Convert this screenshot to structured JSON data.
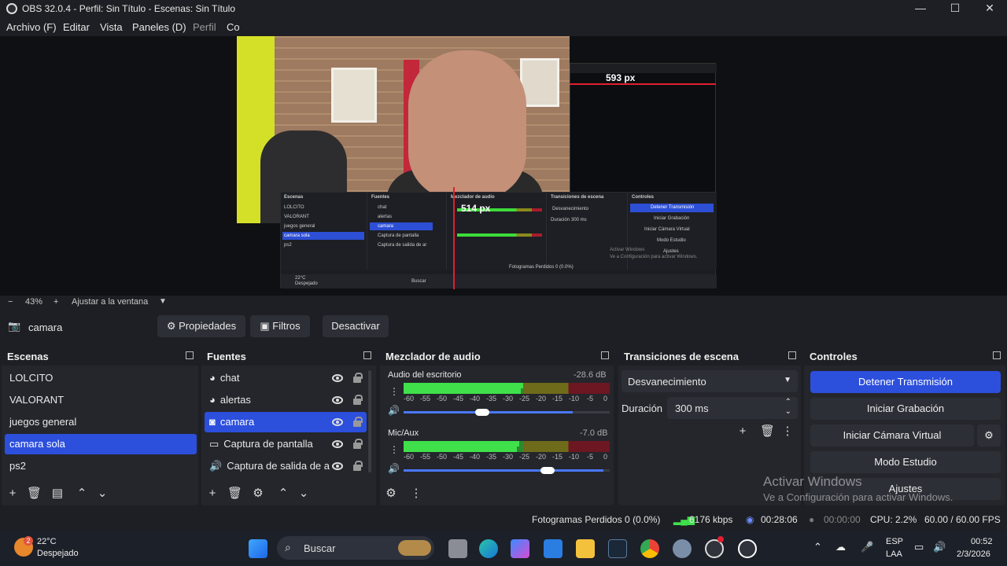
{
  "window": {
    "title": "OBS 32.0.4 - Perfil: Sin Título - Escenas: Sin Título",
    "minimize": "—",
    "maximize": "☐",
    "close": "✕"
  },
  "menu": [
    "Archivo (F)",
    "Editar",
    "Vista",
    "Paneles (D)",
    "Perfil",
    "Co"
  ],
  "preview": {
    "measure_h": "593 px",
    "measure_v": "514 px",
    "mini": {
      "scenes_title": "Escenas",
      "sources_title": "Fuentes",
      "mixer_title": "Mezclador de audio",
      "transitions_title": "Transiciones de escena",
      "controls_title": "Controles",
      "scenes": [
        "LOLCITO",
        "VALORANT",
        "juegos general",
        "camara sola",
        "ps2"
      ],
      "sources": [
        "chat",
        "alertas",
        "camara",
        "Captura de pantalla",
        "Captura de salida de ar"
      ],
      "stop": "Detener Transmisión",
      "record": "Iniciar Grabación",
      "virtual": "Iniciar Cámara Virtual",
      "studio": "Modo Estudio",
      "settings": "Ajustes",
      "fade": "Desvanecimiento",
      "duration": "Duración",
      "duration_val": "300 ms",
      "watermark1": "Activar Windows",
      "watermark2": "Ve a Configuración para activar Windows.",
      "status": "Fotogramas Perdidos 0 (0.0%)",
      "search": "Buscar",
      "weather_temp": "22°C",
      "weather_text": "Despejado"
    }
  },
  "zoom": {
    "minus": "−",
    "value": "43%",
    "plus": "+",
    "fit": "Ajustar a la ventana"
  },
  "source_bar": {
    "name": "camara",
    "properties": "Propiedades",
    "filters": "Filtros",
    "deactivate": "Desactivar"
  },
  "scenes": {
    "title": "Escenas",
    "items": [
      "LOLCITO",
      "VALORANT",
      "juegos general",
      "camara sola",
      "ps2"
    ],
    "selected_index": 3
  },
  "sources": {
    "title": "Fuentes",
    "items": [
      {
        "label": "chat",
        "icon": "browser-icon"
      },
      {
        "label": "alertas",
        "icon": "browser-icon"
      },
      {
        "label": "camara",
        "icon": "camera-icon"
      },
      {
        "label": "Captura de pantalla",
        "icon": "monitor-icon"
      },
      {
        "label": "Captura de salida de a",
        "icon": "speaker-icon"
      }
    ],
    "selected_index": 2
  },
  "mixer": {
    "title": "Mezclador de audio",
    "tracks": [
      {
        "name": "Audio del escritorio",
        "db": "-28.6 dB",
        "level": 0.58,
        "volume": 0.82
      },
      {
        "name": "Mic/Aux",
        "db": "-7.0 dB",
        "level": 0.56,
        "volume": 0.97
      }
    ],
    "scale": [
      "-60",
      "-55",
      "-50",
      "-45",
      "-40",
      "-35",
      "-30",
      "-25",
      "-20",
      "-15",
      "-10",
      "-5",
      "0"
    ]
  },
  "transitions": {
    "title": "Transiciones de escena",
    "selected": "Desvanecimiento",
    "duration_label": "Duración",
    "duration_value": "300 ms"
  },
  "controls": {
    "title": "Controles",
    "stop_stream": "Detener Transmisión",
    "start_record": "Iniciar Grabación",
    "virtual_cam": "Iniciar Cámara Virtual",
    "studio_mode": "Modo Estudio",
    "settings": "Ajustes"
  },
  "watermark": {
    "line1": "Activar Windows",
    "line2": "Ve a Configuración para activar Windows."
  },
  "status": {
    "dropped": "Fotogramas Perdidos 0 (0.0%)",
    "bitrate": "6176 kbps",
    "stream_time": "00:28:06",
    "record_time": "00:00:00",
    "cpu": "CPU: 2.2%",
    "fps": "60.00 / 60.00 FPS"
  },
  "taskbar": {
    "weather_badge": "2",
    "weather_temp": "22°C",
    "weather_text": "Despejado",
    "search": "Buscar",
    "lang1": "ESP",
    "lang2": "LAA",
    "time": "00:52",
    "date": "2/3/2026",
    "apps": [
      "windows-start-icon",
      "file-explorer-icon",
      "edge-icon",
      "m365-icon",
      "store-icon",
      "folder-icon",
      "steam-icon",
      "chrome-icon",
      "settings-icon",
      "obs-icon",
      "search-app-icon"
    ]
  },
  "colors": {
    "accent": "#2c4fdc",
    "background": "#1e1f24",
    "dock": "#24262c",
    "meter_green": "#3fe04a",
    "meter_red": "#e0202e"
  }
}
